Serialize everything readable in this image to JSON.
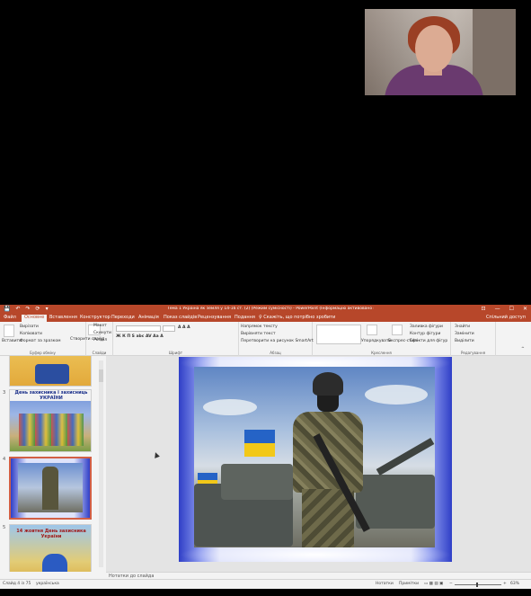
{
  "titlebar": {
    "quick_access": [
      "💾",
      "↶",
      "↷",
      "⟳",
      "▾"
    ],
    "title": "Тема 1 Україна як земля у 14-16 ст. (2) (Режим сумісності) - PowerPoint (Інформацію активовано продукт)",
    "window_controls": [
      "⊡",
      "—",
      "☐",
      "✕"
    ]
  },
  "tabs": [
    "Файл",
    "Основне",
    "Вставлення",
    "Конструктор",
    "Переходи",
    "Анімація",
    "Показ слайдів",
    "Рецензування",
    "Подання"
  ],
  "active_tab": "Основне",
  "search_placeholder": "♀ Скажіть, що потрібно зробити",
  "share_label": "Спільний доступ",
  "ribbon": {
    "clipboard": {
      "paste": "Вставити",
      "cut": "Вирізати",
      "copy": "Копіювати",
      "format_painter": "Формат за зразком",
      "label": "Буфер обміну"
    },
    "slides": {
      "new_slide": "Створити слайд",
      "layout": "Макет",
      "reset": "Скинути",
      "section": "Розділ",
      "label": "Слайди"
    },
    "font": {
      "label": "Шрифт"
    },
    "paragraph": {
      "text_direction": "Напрямок тексту",
      "align_text": "Вирівняти текст",
      "smartart": "Перетворити на рисунок SmartArt",
      "label": "Абзац"
    },
    "drawing": {
      "arrange": "Упорядкувати",
      "quick_styles": "Експрес-стилі",
      "fill": "Заливка фігури",
      "outline": "Контур фігури",
      "effects": "Ефекти для фігур",
      "label": "Креслення"
    },
    "editing": {
      "find": "Знайти",
      "replace": "Замінити",
      "select": "Виділити",
      "label": "Редагування"
    }
  },
  "thumbnails": [
    {
      "number": "",
      "caption": ""
    },
    {
      "number": "3",
      "caption": "День захисника і захисниць УКРАЇНИ"
    },
    {
      "number": "4",
      "caption": ""
    },
    {
      "number": "5",
      "caption": "14 жовтня День захисника України"
    }
  ],
  "notes_placeholder": "Нотатки до слайда",
  "status": {
    "slide_info": "Слайд 4 із 75",
    "language": "українська",
    "notes": "Нотатки",
    "comments": "Примітки",
    "zoom": "63%"
  }
}
